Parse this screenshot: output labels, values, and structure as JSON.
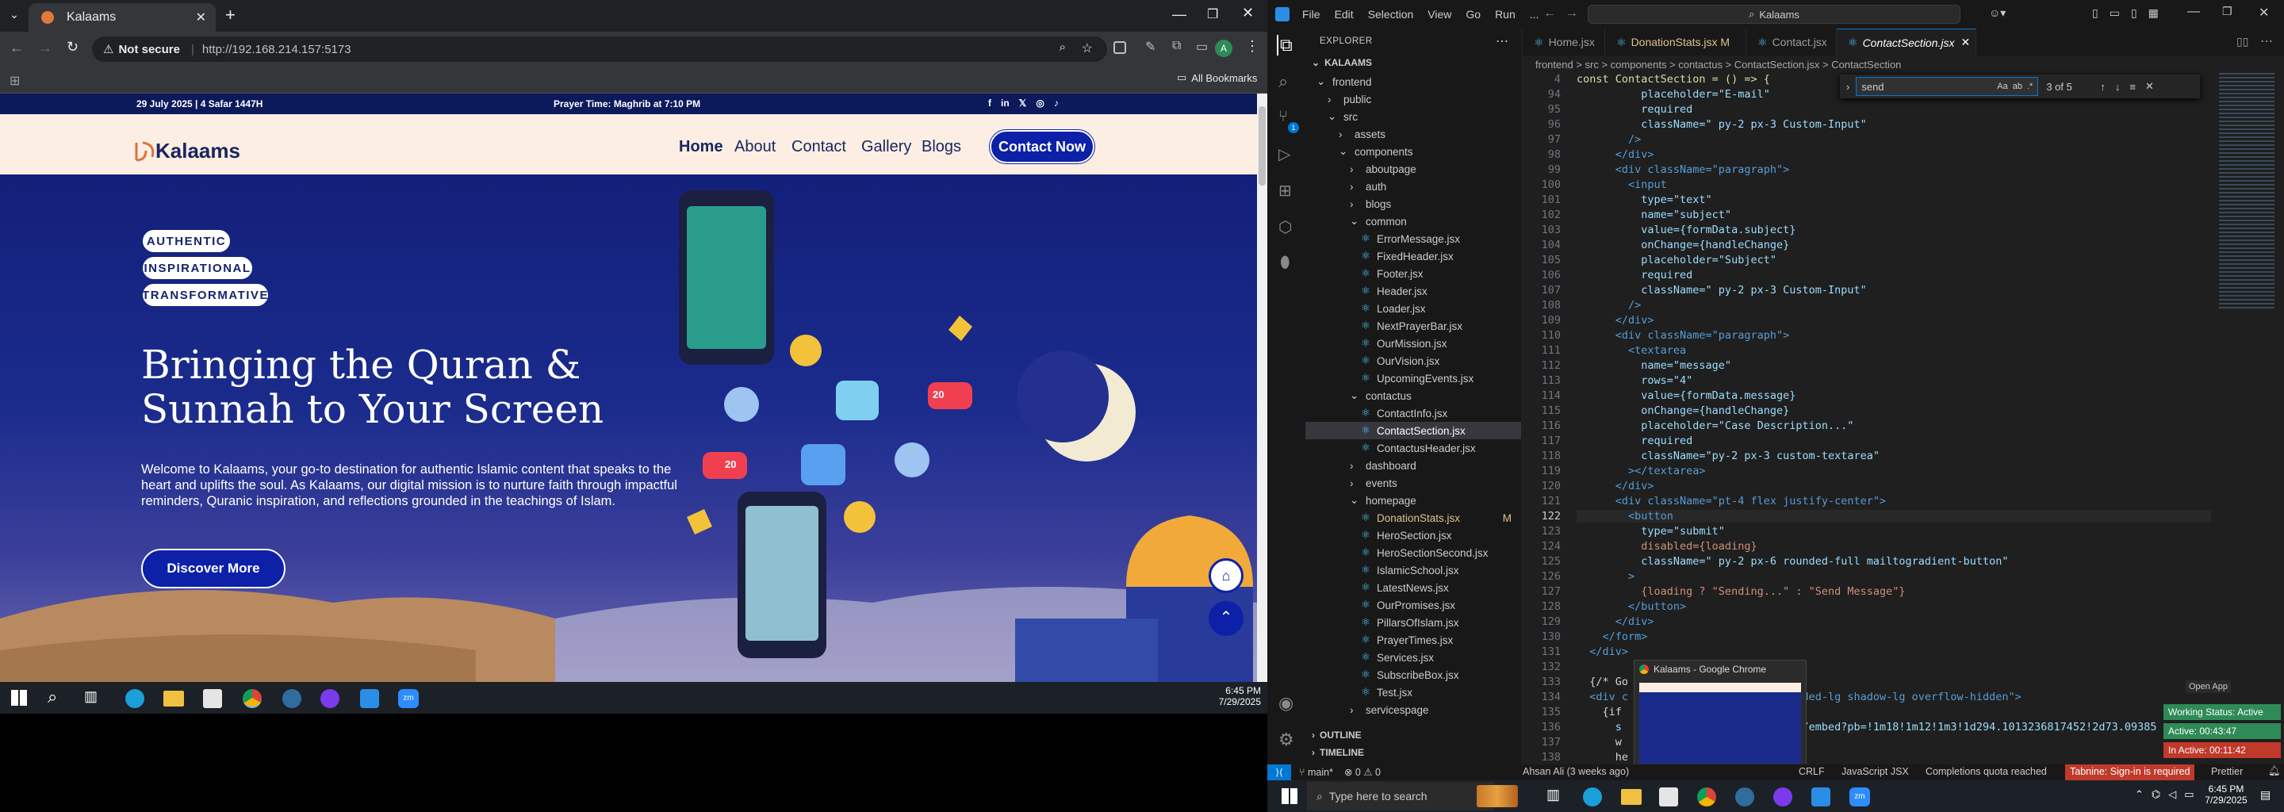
{
  "chrome": {
    "tab_title": "Kalaams",
    "security": "Not secure",
    "url": "http://192.168.214.157:5173",
    "all_bookmarks": "All Bookmarks"
  },
  "site": {
    "date": "29 July 2025 | 4 Safar 1447H",
    "prayer": "Prayer Time: Maghrib at 7:10 PM",
    "logo_text": "Kalaams",
    "nav": [
      "Home",
      "About",
      "Contact",
      "Gallery",
      "Blogs"
    ],
    "contact_button": "Contact Now",
    "pills": [
      "AUTHENTIC",
      "INSPIRATIONAL",
      "TRANSFORMATIVE"
    ],
    "headline_1": "Bringing the Quran &",
    "headline_2": "Sunnah to Your Screen",
    "intro_1": "Welcome to Kalaams, your go-to destination for authentic Islamic content that speaks to the",
    "intro_2": "heart and uplifts the soul. As Kalaams, our digital mission is to nurture faith through impactful",
    "intro_3": "reminders, Quranic inspiration, and reflections grounded in the teachings of Islam.",
    "discover_button": "Discover More",
    "badge_20a": "20",
    "badge_20b": "20"
  },
  "taskbar_left": {
    "time": "6:45 PM",
    "date": "7/29/2025"
  },
  "vscode": {
    "menus": [
      "File",
      "Edit",
      "Selection",
      "View",
      "Go",
      "Run",
      "..."
    ],
    "search": "Kalaams",
    "explorer_title": "EXPLORER",
    "root": "KALAAMS",
    "tree": [
      {
        "name": "frontend",
        "depth": 1,
        "type": "folder-open"
      },
      {
        "name": "public",
        "depth": 2,
        "type": "folder"
      },
      {
        "name": "src",
        "depth": 2,
        "type": "folder-open"
      },
      {
        "name": "assets",
        "depth": 3,
        "type": "folder"
      },
      {
        "name": "components",
        "depth": 3,
        "type": "folder-open"
      },
      {
        "name": "aboutpage",
        "depth": 4,
        "type": "folder"
      },
      {
        "name": "auth",
        "depth": 4,
        "type": "folder"
      },
      {
        "name": "blogs",
        "depth": 4,
        "type": "folder"
      },
      {
        "name": "common",
        "depth": 4,
        "type": "folder-open"
      },
      {
        "name": "ErrorMessage.jsx",
        "depth": 5,
        "type": "file"
      },
      {
        "name": "FixedHeader.jsx",
        "depth": 5,
        "type": "file"
      },
      {
        "name": "Footer.jsx",
        "depth": 5,
        "type": "file"
      },
      {
        "name": "Header.jsx",
        "depth": 5,
        "type": "file"
      },
      {
        "name": "Loader.jsx",
        "depth": 5,
        "type": "file"
      },
      {
        "name": "NextPrayerBar.jsx",
        "depth": 5,
        "type": "file"
      },
      {
        "name": "OurMission.jsx",
        "depth": 5,
        "type": "file"
      },
      {
        "name": "OurVision.jsx",
        "depth": 5,
        "type": "file"
      },
      {
        "name": "UpcomingEvents.jsx",
        "depth": 5,
        "type": "file"
      },
      {
        "name": "contactus",
        "depth": 4,
        "type": "folder-open"
      },
      {
        "name": "ContactInfo.jsx",
        "depth": 5,
        "type": "file"
      },
      {
        "name": "ContactSection.jsx",
        "depth": 5,
        "type": "file-active"
      },
      {
        "name": "ContactusHeader.jsx",
        "depth": 5,
        "type": "file"
      },
      {
        "name": "dashboard",
        "depth": 4,
        "type": "folder"
      },
      {
        "name": "events",
        "depth": 4,
        "type": "folder"
      },
      {
        "name": "homepage",
        "depth": 4,
        "type": "folder-open"
      },
      {
        "name": "DonationStats.jsx",
        "depth": 5,
        "type": "file-mod"
      },
      {
        "name": "HeroSection.jsx",
        "depth": 5,
        "type": "file"
      },
      {
        "name": "HeroSectionSecond.jsx",
        "depth": 5,
        "type": "file"
      },
      {
        "name": "IslamicSchool.jsx",
        "depth": 5,
        "type": "file"
      },
      {
        "name": "LatestNews.jsx",
        "depth": 5,
        "type": "file"
      },
      {
        "name": "OurPromises.jsx",
        "depth": 5,
        "type": "file"
      },
      {
        "name": "PillarsOfIslam.jsx",
        "depth": 5,
        "type": "file"
      },
      {
        "name": "PrayerTimes.jsx",
        "depth": 5,
        "type": "file"
      },
      {
        "name": "Services.jsx",
        "depth": 5,
        "type": "file"
      },
      {
        "name": "SubscribeBox.jsx",
        "depth": 5,
        "type": "file"
      },
      {
        "name": "Test.jsx",
        "depth": 5,
        "type": "file"
      },
      {
        "name": "servicespage",
        "depth": 4,
        "type": "folder"
      }
    ],
    "outline": "OUTLINE",
    "timeline": "TIMELINE",
    "tabs": [
      "Home.jsx",
      "DonationStats.jsx M",
      "Contact.jsx",
      "ContactSection.jsx"
    ],
    "breadcrumb": "frontend > src > components > contactus > ContactSection.jsx > ContactSection",
    "find_text": "send",
    "find_count": "3 of 5",
    "code_lines": [
      {
        "n": "4",
        "t": "const ContactSection = () => {"
      },
      {
        "n": "94",
        "t": "          placeholder=\"E-mail\""
      },
      {
        "n": "95",
        "t": "          required"
      },
      {
        "n": "96",
        "t": "          className=\" py-2 px-3 Custom-Input\""
      },
      {
        "n": "97",
        "t": "        />"
      },
      {
        "n": "98",
        "t": "      </div>"
      },
      {
        "n": "99",
        "t": "      <div className=\"paragraph\">"
      },
      {
        "n": "100",
        "t": "        <input"
      },
      {
        "n": "101",
        "t": "          type=\"text\""
      },
      {
        "n": "102",
        "t": "          name=\"subject\""
      },
      {
        "n": "103",
        "t": "          value={formData.subject}"
      },
      {
        "n": "104",
        "t": "          onChange={handleChange}"
      },
      {
        "n": "105",
        "t": "          placeholder=\"Subject\""
      },
      {
        "n": "106",
        "t": "          required"
      },
      {
        "n": "107",
        "t": "          className=\" py-2 px-3 Custom-Input\""
      },
      {
        "n": "108",
        "t": "        />"
      },
      {
        "n": "109",
        "t": "      </div>"
      },
      {
        "n": "110",
        "t": "      <div className=\"paragraph\">"
      },
      {
        "n": "111",
        "t": "        <textarea"
      },
      {
        "n": "112",
        "t": "          name=\"message\""
      },
      {
        "n": "113",
        "t": "          rows=\"4\""
      },
      {
        "n": "114",
        "t": "          value={formData.message}"
      },
      {
        "n": "115",
        "t": "          onChange={handleChange}"
      },
      {
        "n": "116",
        "t": "          placeholder=\"Case Description...\""
      },
      {
        "n": "117",
        "t": "          required"
      },
      {
        "n": "118",
        "t": "          className=\"py-2 px-3 custom-textarea\""
      },
      {
        "n": "119",
        "t": "        ></textarea>"
      },
      {
        "n": "120",
        "t": "      </div>"
      },
      {
        "n": "121",
        "t": "      <div className=\"pt-4 flex justify-center\">"
      },
      {
        "n": "122",
        "t": "        <button"
      },
      {
        "n": "123",
        "t": "          type=\"submit\""
      },
      {
        "n": "124",
        "t": "          disabled={loading}"
      },
      {
        "n": "125",
        "t": "          className=\" py-2 px-6 rounded-full mailtogradient-button\""
      },
      {
        "n": "126",
        "t": "        >"
      },
      {
        "n": "127",
        "t": "          {loading ? \"Sending...\" : \"Send Message\"}"
      },
      {
        "n": "128",
        "t": "        </button>"
      },
      {
        "n": "129",
        "t": "      </div>"
      },
      {
        "n": "130",
        "t": "    </form>"
      },
      {
        "n": "131",
        "t": "  </div>"
      },
      {
        "n": "132",
        "t": ""
      },
      {
        "n": "133",
        "t": "  {/* Go"
      },
      {
        "n": "134",
        "t": "  <div c                        ounded-lg shadow-lg overflow-hidden\">"
      },
      {
        "n": "135",
        "t": "    {if"
      },
      {
        "n": "136",
        "t": "      s                         aps/embed?pb=!1m18!1m12!1m3!1d294.1013236817452!2d73.09385"
      },
      {
        "n": "137",
        "t": "      w"
      },
      {
        "n": "138",
        "t": "      he"
      }
    ],
    "chrome_preview_title": "Kalaams - Google Chrome",
    "open_app": "Open App",
    "working_status": "Working Status: Active",
    "active_time": "Active: 00:43:47",
    "inactive_time": "In Active: 00:11:42",
    "status_branch": "main*",
    "status_errors": "0 ⚠ 0",
    "status_author": "Ahsan Ali (3 weeks ago)",
    "status_crlf": "CRLF",
    "status_lang": "JavaScript JSX",
    "status_completions": "Completions quota reached",
    "status_tabnine": "Tabnine: Sign-in is required",
    "status_prettier": "Prettier"
  },
  "taskbar_right": {
    "search_placeholder": "Type here to search",
    "time": "6:45 PM",
    "date": "7/29/2025"
  }
}
